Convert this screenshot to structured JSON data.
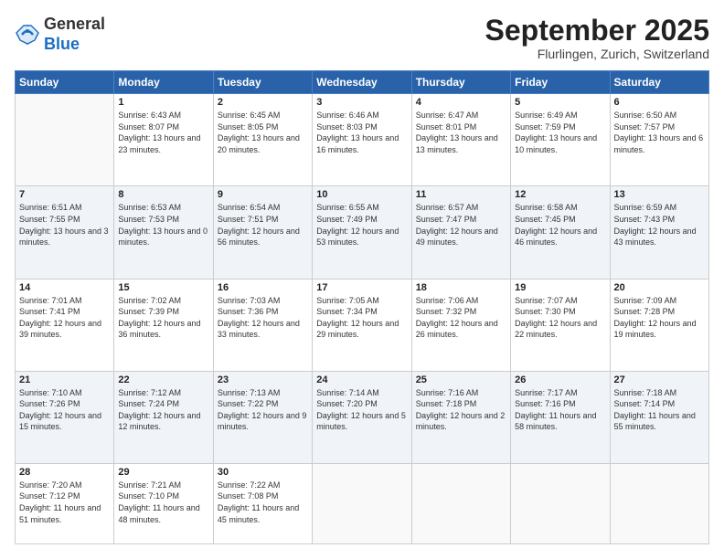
{
  "logo": {
    "general": "General",
    "blue": "Blue"
  },
  "header": {
    "month": "September 2025",
    "location": "Flurlingen, Zurich, Switzerland"
  },
  "days_of_week": [
    "Sunday",
    "Monday",
    "Tuesday",
    "Wednesday",
    "Thursday",
    "Friday",
    "Saturday"
  ],
  "weeks": [
    [
      {
        "day": "",
        "sunrise": "",
        "sunset": "",
        "daylight": ""
      },
      {
        "day": "1",
        "sunrise": "Sunrise: 6:43 AM",
        "sunset": "Sunset: 8:07 PM",
        "daylight": "Daylight: 13 hours and 23 minutes."
      },
      {
        "day": "2",
        "sunrise": "Sunrise: 6:45 AM",
        "sunset": "Sunset: 8:05 PM",
        "daylight": "Daylight: 13 hours and 20 minutes."
      },
      {
        "day": "3",
        "sunrise": "Sunrise: 6:46 AM",
        "sunset": "Sunset: 8:03 PM",
        "daylight": "Daylight: 13 hours and 16 minutes."
      },
      {
        "day": "4",
        "sunrise": "Sunrise: 6:47 AM",
        "sunset": "Sunset: 8:01 PM",
        "daylight": "Daylight: 13 hours and 13 minutes."
      },
      {
        "day": "5",
        "sunrise": "Sunrise: 6:49 AM",
        "sunset": "Sunset: 7:59 PM",
        "daylight": "Daylight: 13 hours and 10 minutes."
      },
      {
        "day": "6",
        "sunrise": "Sunrise: 6:50 AM",
        "sunset": "Sunset: 7:57 PM",
        "daylight": "Daylight: 13 hours and 6 minutes."
      }
    ],
    [
      {
        "day": "7",
        "sunrise": "Sunrise: 6:51 AM",
        "sunset": "Sunset: 7:55 PM",
        "daylight": "Daylight: 13 hours and 3 minutes."
      },
      {
        "day": "8",
        "sunrise": "Sunrise: 6:53 AM",
        "sunset": "Sunset: 7:53 PM",
        "daylight": "Daylight: 13 hours and 0 minutes."
      },
      {
        "day": "9",
        "sunrise": "Sunrise: 6:54 AM",
        "sunset": "Sunset: 7:51 PM",
        "daylight": "Daylight: 12 hours and 56 minutes."
      },
      {
        "day": "10",
        "sunrise": "Sunrise: 6:55 AM",
        "sunset": "Sunset: 7:49 PM",
        "daylight": "Daylight: 12 hours and 53 minutes."
      },
      {
        "day": "11",
        "sunrise": "Sunrise: 6:57 AM",
        "sunset": "Sunset: 7:47 PM",
        "daylight": "Daylight: 12 hours and 49 minutes."
      },
      {
        "day": "12",
        "sunrise": "Sunrise: 6:58 AM",
        "sunset": "Sunset: 7:45 PM",
        "daylight": "Daylight: 12 hours and 46 minutes."
      },
      {
        "day": "13",
        "sunrise": "Sunrise: 6:59 AM",
        "sunset": "Sunset: 7:43 PM",
        "daylight": "Daylight: 12 hours and 43 minutes."
      }
    ],
    [
      {
        "day": "14",
        "sunrise": "Sunrise: 7:01 AM",
        "sunset": "Sunset: 7:41 PM",
        "daylight": "Daylight: 12 hours and 39 minutes."
      },
      {
        "day": "15",
        "sunrise": "Sunrise: 7:02 AM",
        "sunset": "Sunset: 7:39 PM",
        "daylight": "Daylight: 12 hours and 36 minutes."
      },
      {
        "day": "16",
        "sunrise": "Sunrise: 7:03 AM",
        "sunset": "Sunset: 7:36 PM",
        "daylight": "Daylight: 12 hours and 33 minutes."
      },
      {
        "day": "17",
        "sunrise": "Sunrise: 7:05 AM",
        "sunset": "Sunset: 7:34 PM",
        "daylight": "Daylight: 12 hours and 29 minutes."
      },
      {
        "day": "18",
        "sunrise": "Sunrise: 7:06 AM",
        "sunset": "Sunset: 7:32 PM",
        "daylight": "Daylight: 12 hours and 26 minutes."
      },
      {
        "day": "19",
        "sunrise": "Sunrise: 7:07 AM",
        "sunset": "Sunset: 7:30 PM",
        "daylight": "Daylight: 12 hours and 22 minutes."
      },
      {
        "day": "20",
        "sunrise": "Sunrise: 7:09 AM",
        "sunset": "Sunset: 7:28 PM",
        "daylight": "Daylight: 12 hours and 19 minutes."
      }
    ],
    [
      {
        "day": "21",
        "sunrise": "Sunrise: 7:10 AM",
        "sunset": "Sunset: 7:26 PM",
        "daylight": "Daylight: 12 hours and 15 minutes."
      },
      {
        "day": "22",
        "sunrise": "Sunrise: 7:12 AM",
        "sunset": "Sunset: 7:24 PM",
        "daylight": "Daylight: 12 hours and 12 minutes."
      },
      {
        "day": "23",
        "sunrise": "Sunrise: 7:13 AM",
        "sunset": "Sunset: 7:22 PM",
        "daylight": "Daylight: 12 hours and 9 minutes."
      },
      {
        "day": "24",
        "sunrise": "Sunrise: 7:14 AM",
        "sunset": "Sunset: 7:20 PM",
        "daylight": "Daylight: 12 hours and 5 minutes."
      },
      {
        "day": "25",
        "sunrise": "Sunrise: 7:16 AM",
        "sunset": "Sunset: 7:18 PM",
        "daylight": "Daylight: 12 hours and 2 minutes."
      },
      {
        "day": "26",
        "sunrise": "Sunrise: 7:17 AM",
        "sunset": "Sunset: 7:16 PM",
        "daylight": "Daylight: 11 hours and 58 minutes."
      },
      {
        "day": "27",
        "sunrise": "Sunrise: 7:18 AM",
        "sunset": "Sunset: 7:14 PM",
        "daylight": "Daylight: 11 hours and 55 minutes."
      }
    ],
    [
      {
        "day": "28",
        "sunrise": "Sunrise: 7:20 AM",
        "sunset": "Sunset: 7:12 PM",
        "daylight": "Daylight: 11 hours and 51 minutes."
      },
      {
        "day": "29",
        "sunrise": "Sunrise: 7:21 AM",
        "sunset": "Sunset: 7:10 PM",
        "daylight": "Daylight: 11 hours and 48 minutes."
      },
      {
        "day": "30",
        "sunrise": "Sunrise: 7:22 AM",
        "sunset": "Sunset: 7:08 PM",
        "daylight": "Daylight: 11 hours and 45 minutes."
      },
      {
        "day": "",
        "sunrise": "",
        "sunset": "",
        "daylight": ""
      },
      {
        "day": "",
        "sunrise": "",
        "sunset": "",
        "daylight": ""
      },
      {
        "day": "",
        "sunrise": "",
        "sunset": "",
        "daylight": ""
      },
      {
        "day": "",
        "sunrise": "",
        "sunset": "",
        "daylight": ""
      }
    ]
  ]
}
